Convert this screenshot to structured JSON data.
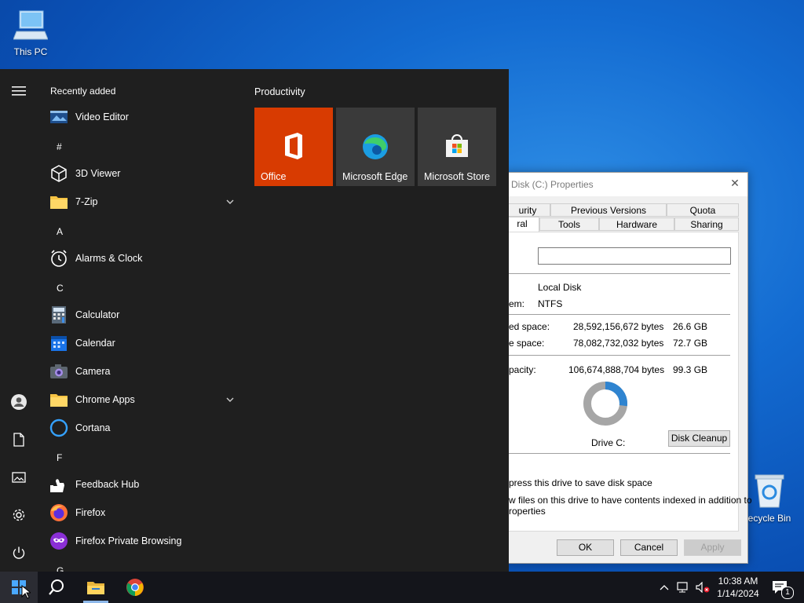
{
  "desktop": {
    "this_pc_label": "This PC",
    "recycle_bin_label": "ecycle Bin"
  },
  "properties": {
    "title": "Disk (C:) Properties",
    "tabs_row1": [
      "urity",
      "Previous Versions",
      "Quota"
    ],
    "tabs_row2": [
      "ral",
      "Tools",
      "Hardware",
      "Sharing"
    ],
    "name_value": "",
    "type_value": "Local Disk",
    "fs_label": "em:",
    "fs_value": "NTFS",
    "used_label": "ed space:",
    "used_bytes": "28,592,156,672 bytes",
    "used_gb": "26.6 GB",
    "free_label": "e space:",
    "free_bytes": "78,082,732,032 bytes",
    "free_gb": "72.7 GB",
    "cap_label": "pacity:",
    "cap_bytes": "106,674,888,704 bytes",
    "cap_gb": "99.3 GB",
    "drive_label": "Drive C:",
    "used_fraction": 0.268,
    "disk_cleanup": "Disk Cleanup",
    "compress_text": "press this drive to save disk space",
    "index_text_1": "w files on this drive to have contents indexed in addition to",
    "index_text_2": "roperties",
    "ok": "OK",
    "cancel": "Cancel",
    "apply": "Apply"
  },
  "start_menu": {
    "recently_added_label": "Recently added",
    "productivity_label": "Productivity",
    "apps": [
      {
        "name": "Video Editor",
        "icon": "video-editor-icon"
      },
      {
        "letter": "#"
      },
      {
        "name": "3D Viewer",
        "icon": "3d-viewer-icon"
      },
      {
        "name": "7-Zip",
        "icon": "folder-icon",
        "expandable": true
      },
      {
        "letter": "A"
      },
      {
        "name": "Alarms & Clock",
        "icon": "alarm-clock-icon"
      },
      {
        "letter": "C"
      },
      {
        "name": "Calculator",
        "icon": "calculator-icon"
      },
      {
        "name": "Calendar",
        "icon": "calendar-icon"
      },
      {
        "name": "Camera",
        "icon": "camera-icon"
      },
      {
        "name": "Chrome Apps",
        "icon": "folder-icon",
        "expandable": true
      },
      {
        "name": "Cortana",
        "icon": "cortana-icon"
      },
      {
        "letter": "F"
      },
      {
        "name": "Feedback Hub",
        "icon": "feedback-hub-icon"
      },
      {
        "name": "Firefox",
        "icon": "firefox-icon"
      },
      {
        "name": "Firefox Private Browsing",
        "icon": "firefox-private-icon"
      },
      {
        "letter": "G"
      }
    ],
    "tiles": [
      {
        "label": "Office",
        "color": "#d83b01",
        "icon": "office-icon"
      },
      {
        "label": "Microsoft Edge",
        "color": "#3a3a3a",
        "icon": "edge-icon"
      },
      {
        "label": "Microsoft Store",
        "color": "#3a3a3a",
        "icon": "store-icon"
      }
    ]
  },
  "taskbar": {
    "time": "10:38 AM",
    "date": "1/14/2024",
    "notification_count": "1"
  }
}
